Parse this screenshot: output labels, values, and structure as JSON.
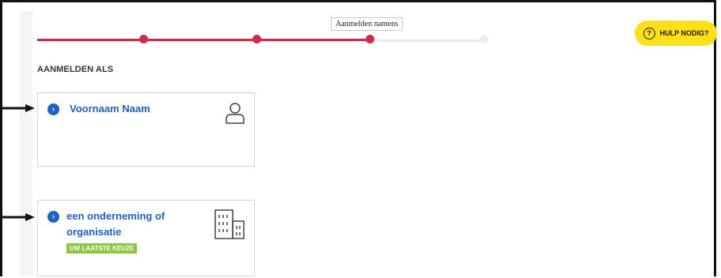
{
  "stepper": {
    "tooltip": "Aanmelden namens",
    "steps_total": 4,
    "steps_completed": 3
  },
  "help": {
    "label": "HULP NODIG?",
    "icon_glyph": "?"
  },
  "section": {
    "title": "AANMELDEN ALS"
  },
  "options": [
    {
      "label": "Voornaam Naam",
      "icon": "user-icon"
    },
    {
      "label": "een onderneming of organisatie",
      "badge": "UW LAATSTE KEUZE",
      "icon": "building-icon"
    }
  ],
  "colors": {
    "accent": "#1d62c8",
    "progress": "#d0294a",
    "help": "#ffe11a",
    "badge": "#8dc73f"
  }
}
